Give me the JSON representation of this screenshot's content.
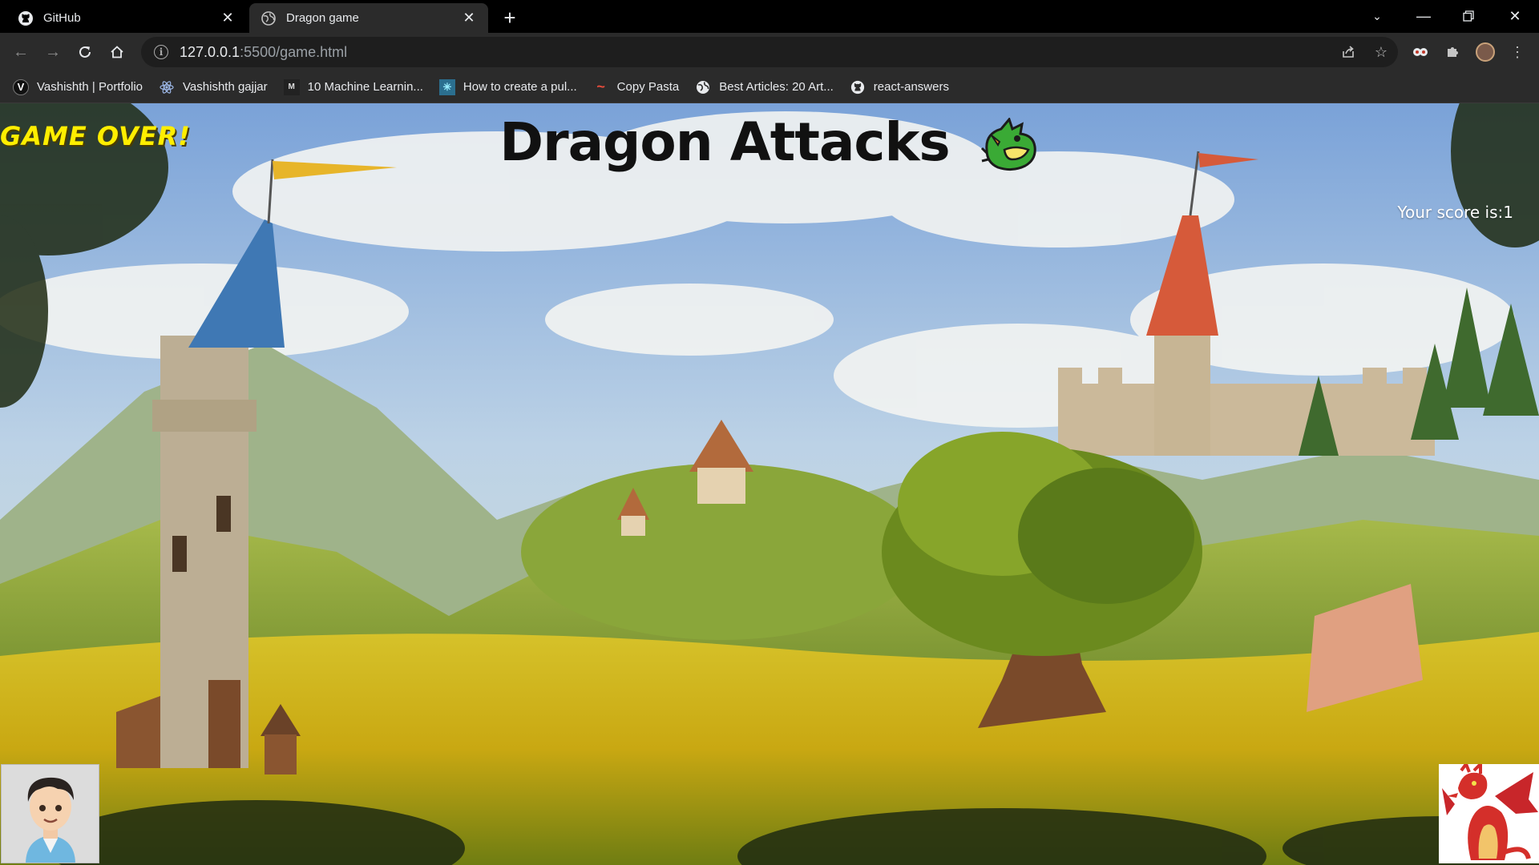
{
  "browser": {
    "tabs": [
      {
        "title": "GitHub",
        "icon": "github-icon",
        "active": false
      },
      {
        "title": "Dragon game",
        "icon": "globe-icon",
        "active": true
      }
    ],
    "address": {
      "host": "127.0.0.1",
      "rest": ":5500/game.html"
    },
    "bookmarks": [
      {
        "label": "Vashishth | Portfolio",
        "icon": "vercel-v-icon"
      },
      {
        "label": "Vashishth gajjar",
        "icon": "react-atom-icon"
      },
      {
        "label": "10 Machine Learnin...",
        "icon": "article-icon"
      },
      {
        "label": "How to create a pul...",
        "icon": "snowflake-icon"
      },
      {
        "label": "Copy Pasta",
        "icon": "copypasta-icon"
      },
      {
        "label": "Best Articles: 20 Art...",
        "icon": "globe-icon"
      },
      {
        "label": "react-answers",
        "icon": "github-icon"
      }
    ]
  },
  "game": {
    "status": "GAME OVER!",
    "title": "Dragon Attacks",
    "score_label": "Your score is:",
    "score": "1",
    "colors": {
      "status": "#ffee00",
      "title": "#111111",
      "score": "#ffffff"
    }
  }
}
